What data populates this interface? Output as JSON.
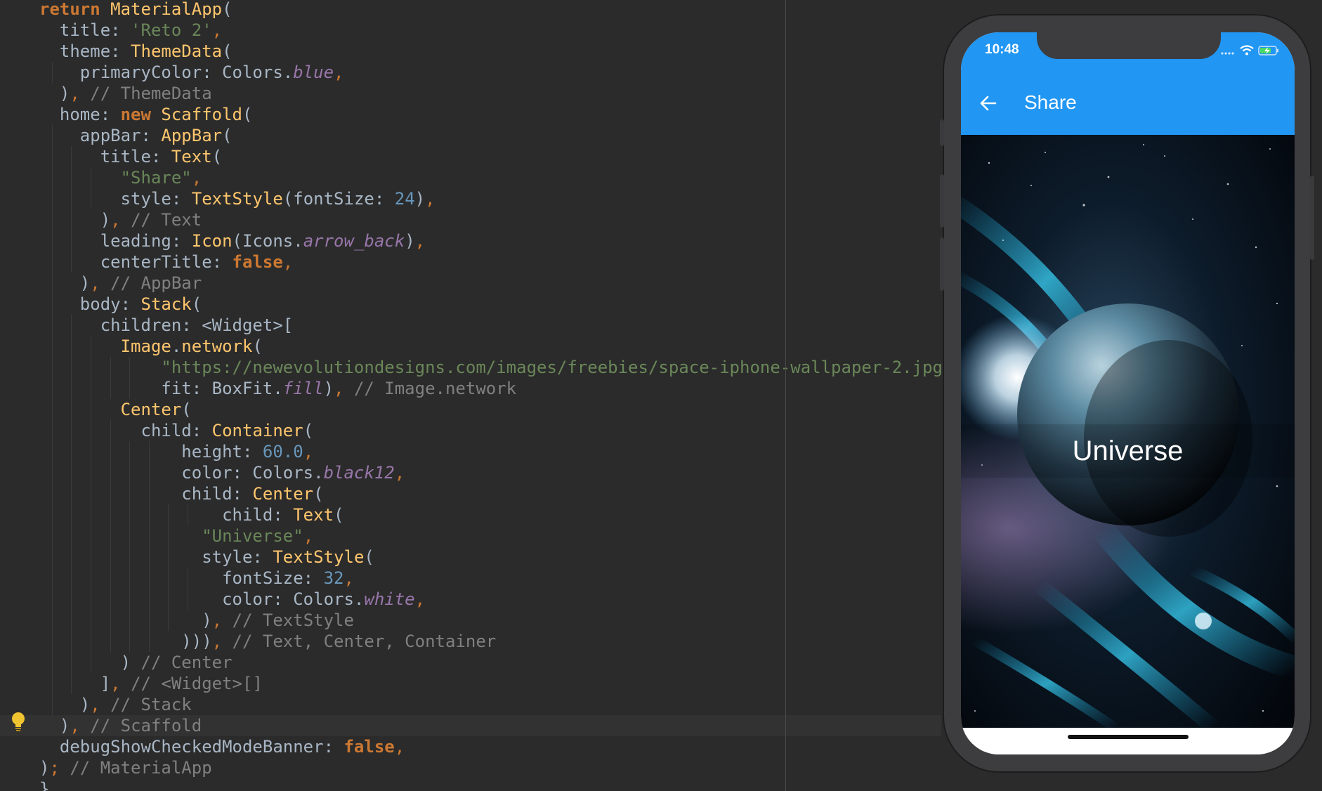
{
  "editor": {
    "lines": [
      [
        [
          "t-kw",
          "return "
        ],
        [
          "t-cls",
          "MaterialApp"
        ],
        [
          "t-id",
          "("
        ]
      ],
      [
        [
          "t-id",
          "  title: "
        ],
        [
          "t-str",
          "'Reto 2'"
        ],
        [
          "t-pun",
          ","
        ]
      ],
      [
        [
          "t-id",
          "  theme: "
        ],
        [
          "t-cls",
          "ThemeData"
        ],
        [
          "t-id",
          "("
        ]
      ],
      [
        [
          "t-id",
          "    primaryColor: Colors."
        ],
        [
          "t-cst",
          "blue"
        ],
        [
          "t-pun",
          ","
        ]
      ],
      [
        [
          "t-id",
          "  )"
        ],
        [
          "t-pun",
          ", "
        ],
        [
          "t-cmt",
          "// ThemeData"
        ]
      ],
      [
        [
          "t-id",
          "  home: "
        ],
        [
          "t-kw",
          "new "
        ],
        [
          "t-cls",
          "Scaffold"
        ],
        [
          "t-id",
          "("
        ]
      ],
      [
        [
          "t-id",
          "    appBar: "
        ],
        [
          "t-cls",
          "AppBar"
        ],
        [
          "t-id",
          "("
        ]
      ],
      [
        [
          "t-id",
          "      title: "
        ],
        [
          "t-cls",
          "Text"
        ],
        [
          "t-id",
          "("
        ]
      ],
      [
        [
          "t-str",
          "        \"Share\""
        ],
        [
          "t-pun",
          ","
        ]
      ],
      [
        [
          "t-id",
          "        style: "
        ],
        [
          "t-cls",
          "TextStyle"
        ],
        [
          "t-id",
          "(fontSize: "
        ],
        [
          "t-num",
          "24"
        ],
        [
          "t-id",
          ")"
        ],
        [
          "t-pun",
          ","
        ]
      ],
      [
        [
          "t-id",
          "      )"
        ],
        [
          "t-pun",
          ", "
        ],
        [
          "t-cmt",
          "// Text"
        ]
      ],
      [
        [
          "t-id",
          "      leading: "
        ],
        [
          "t-cls",
          "Icon"
        ],
        [
          "t-id",
          "(Icons."
        ],
        [
          "t-cst",
          "arrow_back"
        ],
        [
          "t-id",
          ")"
        ],
        [
          "t-pun",
          ","
        ]
      ],
      [
        [
          "t-id",
          "      centerTitle: "
        ],
        [
          "t-kw",
          "false"
        ],
        [
          "t-pun",
          ","
        ]
      ],
      [
        [
          "t-id",
          "    )"
        ],
        [
          "t-pun",
          ", "
        ],
        [
          "t-cmt",
          "// AppBar"
        ]
      ],
      [
        [
          "t-id",
          "    body: "
        ],
        [
          "t-cls",
          "Stack"
        ],
        [
          "t-id",
          "("
        ]
      ],
      [
        [
          "t-id",
          "      children: <Widget>["
        ]
      ],
      [
        [
          "t-cls",
          "        Image"
        ],
        [
          "t-id",
          "."
        ],
        [
          "t-cls",
          "network"
        ],
        [
          "t-id",
          "("
        ]
      ],
      [
        [
          "t-str",
          "            \"https://newevolutiondesigns.com/images/freebies/space-iphone-wallpaper-2.jpg\""
        ],
        [
          "t-pun",
          ","
        ]
      ],
      [
        [
          "t-id",
          "            fit: BoxFit."
        ],
        [
          "t-cst",
          "fill"
        ],
        [
          "t-id",
          ")"
        ],
        [
          "t-pun",
          ", "
        ],
        [
          "t-cmt",
          "// Image.network"
        ]
      ],
      [
        [
          "t-cls",
          "        Center"
        ],
        [
          "t-id",
          "("
        ]
      ],
      [
        [
          "t-id",
          "          child: "
        ],
        [
          "t-cls",
          "Container"
        ],
        [
          "t-id",
          "("
        ]
      ],
      [
        [
          "t-id",
          "              height: "
        ],
        [
          "t-num",
          "60.0"
        ],
        [
          "t-pun",
          ","
        ]
      ],
      [
        [
          "t-id",
          "              color: Colors."
        ],
        [
          "t-cst",
          "black12"
        ],
        [
          "t-pun",
          ","
        ]
      ],
      [
        [
          "t-id",
          "              child: "
        ],
        [
          "t-cls",
          "Center"
        ],
        [
          "t-id",
          "("
        ]
      ],
      [
        [
          "t-id",
          "                  child: "
        ],
        [
          "t-cls",
          "Text"
        ],
        [
          "t-id",
          "("
        ]
      ],
      [
        [
          "t-str",
          "                \"Universe\""
        ],
        [
          "t-pun",
          ","
        ]
      ],
      [
        [
          "t-id",
          "                style: "
        ],
        [
          "t-cls",
          "TextStyle"
        ],
        [
          "t-id",
          "("
        ]
      ],
      [
        [
          "t-id",
          "                  fontSize: "
        ],
        [
          "t-num",
          "32"
        ],
        [
          "t-pun",
          ","
        ]
      ],
      [
        [
          "t-id",
          "                  color: Colors."
        ],
        [
          "t-cst",
          "white"
        ],
        [
          "t-pun",
          ","
        ]
      ],
      [
        [
          "t-id",
          "                )"
        ],
        [
          "t-pun",
          ", "
        ],
        [
          "t-cmt",
          "// TextStyle"
        ]
      ],
      [
        [
          "t-id",
          "              )))"
        ],
        [
          "t-pun",
          ", "
        ],
        [
          "t-cmt",
          "// Text, Center, Container"
        ]
      ],
      [
        [
          "t-id",
          "        ) "
        ],
        [
          "t-cmt",
          "// Center"
        ]
      ],
      [
        [
          "t-id",
          "      ]"
        ],
        [
          "t-pun",
          ", "
        ],
        [
          "t-cmt",
          "// <Widget>[]"
        ]
      ],
      [
        [
          "t-id",
          "    )"
        ],
        [
          "t-pun",
          ", "
        ],
        [
          "t-cmt",
          "// Stack"
        ]
      ],
      [
        [
          "t-id",
          "  )"
        ],
        [
          "t-pun",
          ", "
        ],
        [
          "t-cmt",
          "// Scaffold"
        ]
      ],
      [
        [
          "t-id",
          "  debugShowCheckedModeBanner: "
        ],
        [
          "t-kw",
          "false"
        ],
        [
          "t-pun",
          ","
        ]
      ],
      [
        [
          "t-id",
          ")"
        ],
        [
          "t-pun",
          "; "
        ],
        [
          "t-cmt",
          "// MaterialApp"
        ]
      ],
      [
        [
          "t-id",
          "}"
        ]
      ]
    ]
  },
  "phone": {
    "time": "10:48",
    "appbar_title": "Share",
    "center_text": "Universe",
    "appbar_color": "#2196f3"
  },
  "icons": {
    "back": "arrow-back-icon",
    "wifi": "wifi-icon",
    "battery": "battery-charging-icon",
    "signal": "signal-icon",
    "hint": "lightbulb-icon"
  }
}
